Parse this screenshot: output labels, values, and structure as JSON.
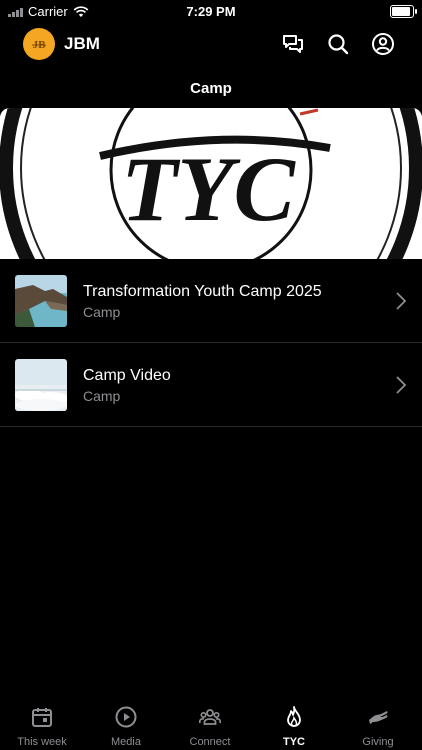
{
  "status_bar": {
    "carrier": "Carrier",
    "time": "7:29 PM",
    "battery_level": 1.0
  },
  "header": {
    "app_name": "JBM",
    "avatar_initials": "JB",
    "avatar_color": "#f5a623"
  },
  "screen": {
    "title": "Camp",
    "banner_text": "TYC"
  },
  "items": [
    {
      "title": "Transformation Youth Camp 2025",
      "subtitle": "Camp",
      "thumb_icon": "coastline-photo"
    },
    {
      "title": "Camp Video",
      "subtitle": "Camp",
      "thumb_icon": "clouds-photo"
    }
  ],
  "tabs": [
    {
      "label": "This week",
      "icon": "calendar-icon",
      "active": false
    },
    {
      "label": "Media",
      "icon": "play-circle-icon",
      "active": false
    },
    {
      "label": "Connect",
      "icon": "people-icon",
      "active": false
    },
    {
      "label": "TYC",
      "icon": "flame-icon",
      "active": true
    },
    {
      "label": "Giving",
      "icon": "giving-hand-icon",
      "active": false
    }
  ],
  "colors": {
    "background": "#000000",
    "secondary_text": "#8e8e93",
    "divider": "#2a2a2a",
    "accent": "#f5a623"
  }
}
